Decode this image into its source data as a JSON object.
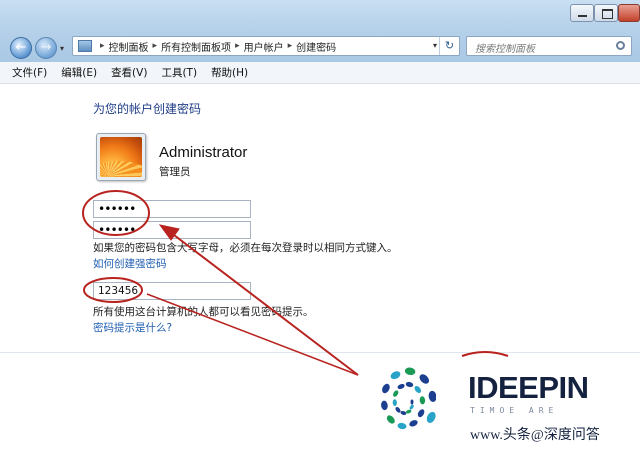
{
  "address_bar": {
    "breadcrumbs": [
      "控制面板",
      "所有控制面板项",
      "用户帐户",
      "创建密码"
    ]
  },
  "search": {
    "placeholder": "搜索控制面板"
  },
  "menu": [
    "文件(F)",
    "编辑(E)",
    "查看(V)",
    "工具(T)",
    "帮助(H)"
  ],
  "main": {
    "title": "为您的帐户创建密码",
    "user": {
      "name": "Administrator",
      "role": "管理员"
    },
    "new_password_value": "••••••",
    "confirm_password_value": "••••••",
    "caps_note": "如果您的密码包含大写字母，必须在每次登录时以相同方式键入。",
    "strong_password_link": "如何创建强密码",
    "hint_value": "123456",
    "hint_note": "所有使用这台计算机的人都可以看见密码提示。",
    "hint_help_link": "密码提示是什么?"
  },
  "annotation": {
    "color": "#b8231f"
  },
  "watermark": {
    "brand": "IDEEPIN",
    "subtitle": "TIMOE ARE",
    "footer": "www.头条@深度问答"
  }
}
